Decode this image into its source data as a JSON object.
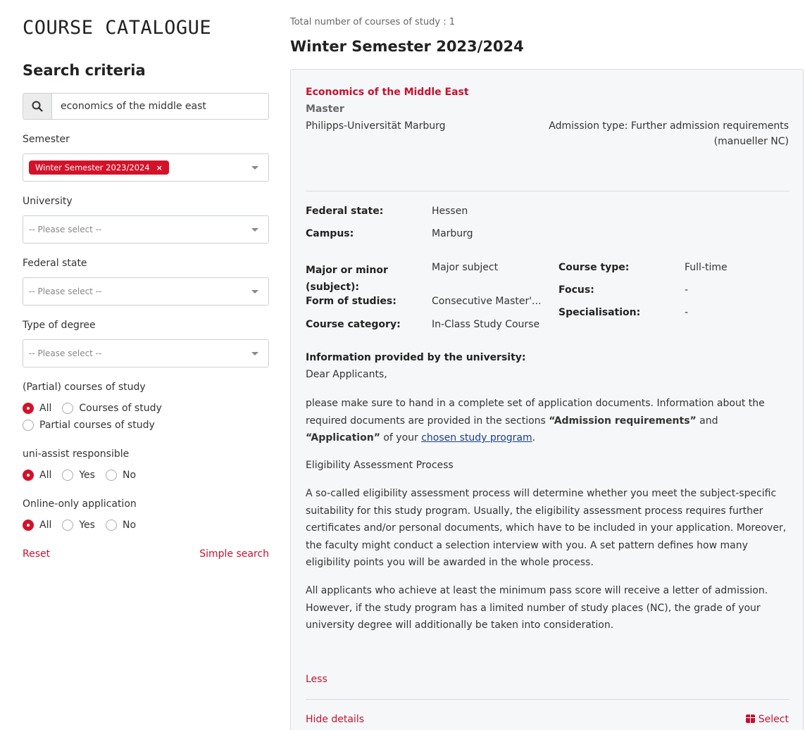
{
  "sidebar": {
    "catalogue_title": "COURSE CATALOGUE",
    "criteria_title": "Search criteria",
    "search_value": "economics of the middle east",
    "semester_label": "Semester",
    "semester_tag": "Winter Semester 2023/2024",
    "semester_tag_remove": "×",
    "university_label": "University",
    "university_placeholder": "-- Please select --",
    "federal_state_label": "Federal state",
    "federal_state_placeholder": "-- Please select --",
    "degree_label": "Type of degree",
    "degree_placeholder": "-- Please select --",
    "partial_label": "(Partial) courses of study",
    "partial_options": [
      "All",
      "Courses of study",
      "Partial courses of study"
    ],
    "uniassist_label": "uni-assist responsible",
    "uniassist_options": [
      "All",
      "Yes",
      "No"
    ],
    "online_label": "Online-only application",
    "online_options": [
      "All",
      "Yes",
      "No"
    ],
    "reset": "Reset",
    "simple_search": "Simple search"
  },
  "main": {
    "total_count": "Total number of courses of study : 1",
    "semester_heading": "Winter Semester 2023/2024"
  },
  "course": {
    "title": "Economics of the Middle East",
    "degree": "Master",
    "university": "Philipps-Universität Marburg",
    "admission_line1": "Admission type: Further admission requirements",
    "admission_line2": "(manueller NC)",
    "federal_state_key": "Federal state:",
    "federal_state_val": "Hessen",
    "campus_key": "Campus:",
    "campus_val": "Marburg",
    "major_key_line1": "Major or minor",
    "major_key_line2": "(subject):",
    "major_val": "Major subject",
    "form_key": "Form of studies:",
    "form_val": "Consecutive Master'...",
    "category_key": "Course category:",
    "category_val": "In-Class Study Course",
    "course_type_key": "Course type:",
    "course_type_val": "Full-time",
    "focus_key": "Focus:",
    "focus_val": "-",
    "specialisation_key": "Specialisation:",
    "specialisation_val": "-",
    "info_heading": "Information provided by the university:",
    "greeting": "Dear Applicants,",
    "para1_a": "please make sure to hand in a complete set of application documents. Information about the required documents are provided in the sections ",
    "para1_b": "“Admission requirements”",
    "para1_c": " and ",
    "para1_d": "“Application”",
    "para1_e": " of your ",
    "para1_link": "chosen study program",
    "para1_f": ".",
    "eligibility_heading": "Eligibility Assessment Process",
    "para2": "A so-called eligibility assessment process will determine whether you meet the subject-specific suitability for this study program. Usually, the eligibility assessment process requires further certificates and/or personal documents, which have to be included in your application. Moreover, the faculty might conduct a selection interview with you. A set pattern defines how many eligibility points you will be awarded in the whole process.",
    "para3": "All applicants who achieve at least the minimum pass score will receive a letter of admission. However, if the study program has a limited number of study places (NC), the grade of your university degree will additionally be taken into consideration.",
    "less": "Less",
    "hide_details": "Hide details",
    "select": "Select"
  }
}
